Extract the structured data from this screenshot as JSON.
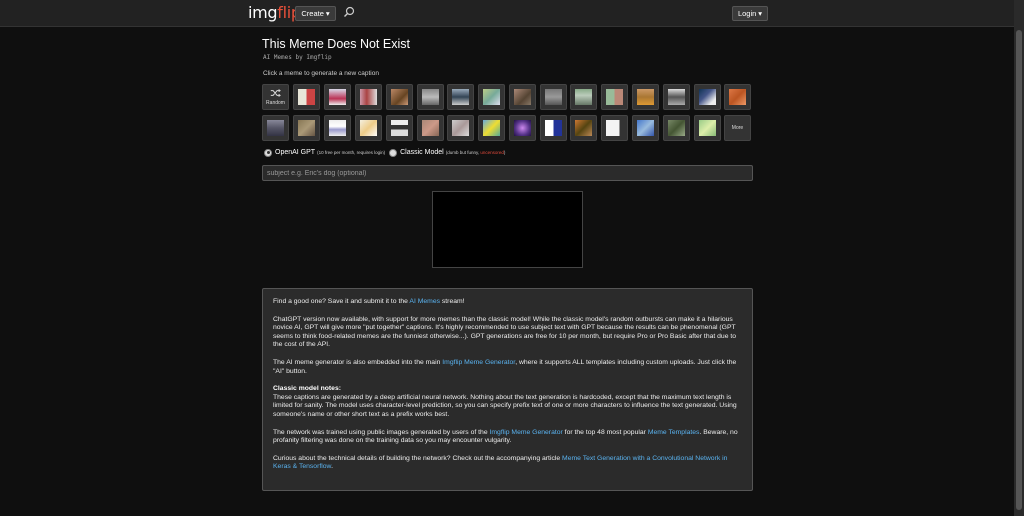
{
  "header": {
    "logo_main": "img",
    "logo_accent": "flip",
    "create_label": "Create",
    "login_label": "Login"
  },
  "page": {
    "title": "This Meme Does Not Exist",
    "subtitle": "AI Memes by Imgflip",
    "hint": "Click a meme to generate a new caption"
  },
  "templates": {
    "random_label": "Random",
    "more_label": "More"
  },
  "models": {
    "openai_label": "OpenAI GPT",
    "openai_note": "(10 free per month, requires login)",
    "classic_label": "Classic Model",
    "classic_note": "(dumb but funny, ",
    "classic_note_accent": "uncensored",
    "classic_note_end": ")"
  },
  "subject": {
    "placeholder": "subject e.g. Eric's dog (optional)"
  },
  "info": {
    "p1_a": "Find a good one? Save it and submit it to the ",
    "p1_link": "AI Memes",
    "p1_b": " stream!",
    "p2": "ChatGPT version now available, with support for more memes than the classic model! While the classic model's random outbursts can make it a hilarious novice AI, GPT will give more \"put together\" captions. It's highly recommended to use subject text with GPT because the results can be phenomenal (GPT seems to think food-related memes are the funniest otherwise...). GPT generations are free for 10 per month, but require Pro or Pro Basic after that due to the cost of the API.",
    "p3_a": "The AI meme generator is also embedded into the main ",
    "p3_link": "Imgflip Meme Generator",
    "p3_b": ", where it supports ALL templates including custom uploads. Just click the \"AI\" button.",
    "p4_title": "Classic model notes:",
    "p4": "These captions are generated by a deep artificial neural network. Nothing about the text generation is hardcoded, except that the maximum text length is limited for sanity. The model uses character-level prediction, so you can specify prefix text of one or more characters to influence the text generated. Using someone's name or other short text as a prefix works best.",
    "p5_a": "The network was trained using public images generated by users of the ",
    "p5_link1": "Imgflip Meme Generator",
    "p5_b": " for the top 48 most popular ",
    "p5_link2": "Meme Templates",
    "p5_c": ". Beware, no profanity filtering was done on the training data so you may encounter vulgarity.",
    "p6_a": "Curious about the technical details of building the network? Check out the accompanying article ",
    "p6_link": "Meme Text Generation with a Convolutional Network in Keras & Tensorflow",
    "p6_b": "."
  },
  "colors": {
    "accent": "#e8503a",
    "link": "#5ab3f0",
    "background": "#0f0f0f",
    "panel": "#2b2b2b"
  },
  "icons": {
    "search": "search-icon",
    "shuffle": "shuffle-icon",
    "caret": "chevron-down-icon"
  }
}
